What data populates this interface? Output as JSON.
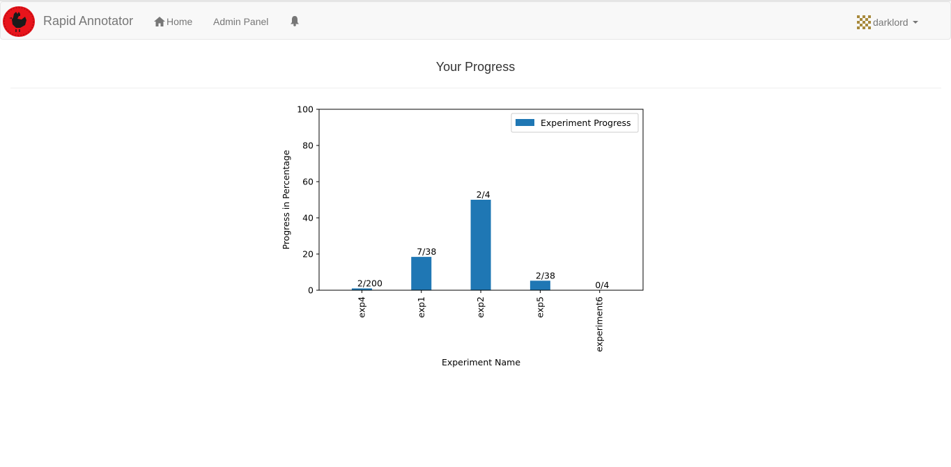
{
  "navbar": {
    "brand": "Rapid Annotator",
    "home_label": "Home",
    "admin_label": "Admin Panel",
    "user_name": "darklord",
    "icons": {
      "logo": "rooster-logo",
      "home": "home-icon",
      "notifications": "bell-icon",
      "user": "identicon-avatar",
      "dropdown": "caret-down-icon"
    },
    "logo_color": "#e8141b",
    "avatar_color": "#a88a3c"
  },
  "page": {
    "title": "Your Progress"
  },
  "chart_data": {
    "type": "bar",
    "categories": [
      "exp4",
      "exp1",
      "exp2",
      "exp5",
      "experiment6"
    ],
    "series": [
      {
        "name": "Experiment Progress",
        "values": [
          1,
          18.42,
          50,
          5.26,
          0
        ]
      }
    ],
    "data_labels": [
      "2/200",
      "7/38",
      "2/4",
      "2/38",
      "0/4"
    ],
    "xlabel": "Experiment Name",
    "ylabel": "Progress in Percentage",
    "ylim": [
      0,
      100
    ],
    "yticks": [
      "0",
      "20",
      "40",
      "60",
      "80",
      "100"
    ],
    "legend_position": "top-right",
    "grid": false,
    "bar_color": "#1f77b4"
  }
}
